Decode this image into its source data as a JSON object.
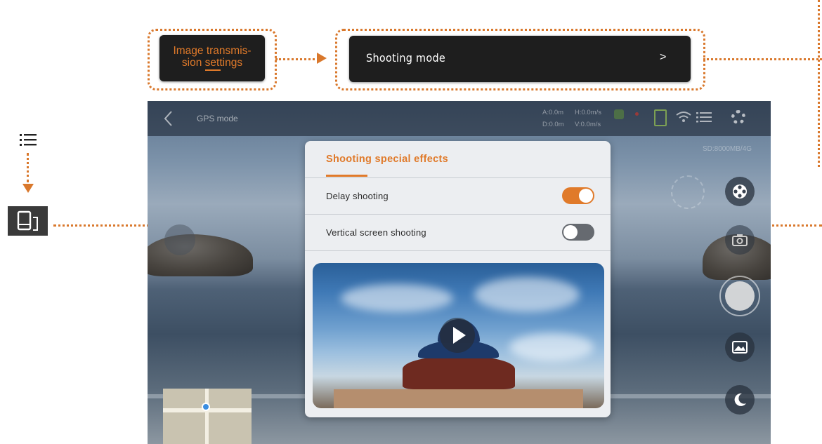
{
  "annotations": {
    "image_transmission_settings": "Image transmis-\nsion settings",
    "shooting_mode": {
      "label": "Shooting  mode",
      "chevron": ">"
    }
  },
  "app": {
    "back_icon": "chevron-left-icon",
    "mode_label": "GPS mode",
    "telemetry": {
      "altitude": "A:0.0m",
      "height_speed": "H:0.0m/s",
      "distance": "D:0.0m",
      "vertical_speed": "V:0.0m/s"
    },
    "sd_status": "SD:8000MB/4G",
    "side_controls": [
      "film-reel-icon",
      "camera-icon",
      "shutter-button",
      "gallery-icon",
      "moon-icon"
    ]
  },
  "panel": {
    "title": "Shooting special effects",
    "settings": [
      {
        "label": "Delay shooting",
        "enabled": true
      },
      {
        "label": "Vertical screen shooting",
        "enabled": false
      }
    ],
    "preview_icon": "play-icon"
  },
  "colors": {
    "accent": "#e07a2a",
    "toggle_off": "#666a70",
    "panel_bg": "#eceef1"
  }
}
